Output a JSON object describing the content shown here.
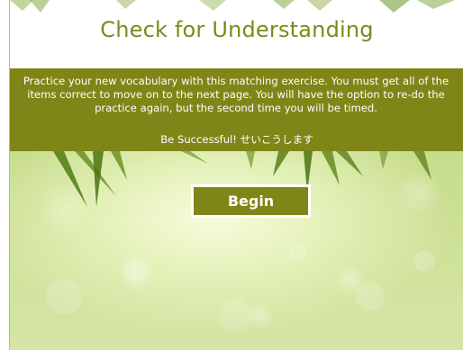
{
  "slide": {
    "title": "Check for Understanding",
    "instructions": "Practice your new vocabulary with this matching exercise. You must get all of the items correct to move on to the next page. You will have the option to re-do the practice again, but the second time you will be timed.",
    "encouragement": "Be Successful! せいこうします",
    "begin_label": "Begin"
  },
  "colors": {
    "accent": "#7f8617",
    "title_text": "#7a8a1c",
    "background": "#c7dc8c"
  }
}
